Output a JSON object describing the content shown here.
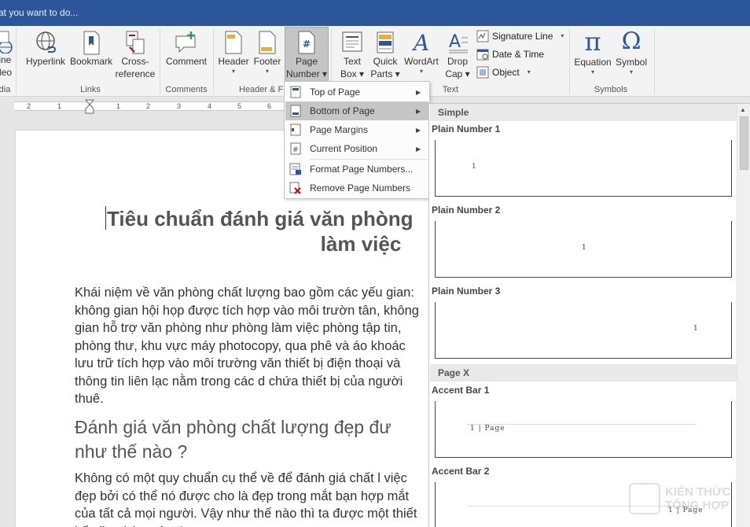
{
  "titlebar": {
    "tell_me": "at you want to do..."
  },
  "ribbon": {
    "left_cut": {
      "label1": "line",
      "label2": "deo",
      "group": "dia"
    },
    "hyperlink": "Hyperlink",
    "bookmark": "Bookmark",
    "cross_reference_1": "Cross-",
    "cross_reference_2": "reference",
    "links_group": "Links",
    "comment": "Comment",
    "comments_group": "Comments",
    "header": "Header",
    "footer": "Footer",
    "page_number_1": "Page",
    "page_number_2": "Number",
    "header_footer_group": "Header & F",
    "text_box_1": "Text",
    "text_box_2": "Box",
    "quick_parts_1": "Quick",
    "quick_parts_2": "Parts",
    "wordart": "WordArt",
    "drop_cap_1": "Drop",
    "drop_cap_2": "Cap",
    "signature_line": "Signature Line",
    "date_time": "Date & Time",
    "object": "Object",
    "text_group": "Text",
    "equation": "Equation",
    "symbol": "Symbol",
    "symbols_group": "Symbols"
  },
  "ruler": {
    "marks": [
      "2",
      "1",
      "1",
      "2",
      "3",
      "4",
      "5",
      "6"
    ]
  },
  "menu": {
    "items": [
      {
        "label": "Top of Page",
        "submenu": true
      },
      {
        "label": "Bottom of Page",
        "submenu": true
      },
      {
        "label": "Page Margins",
        "submenu": true
      },
      {
        "label": "Current Position",
        "submenu": true
      },
      {
        "label": "Format Page Numbers...",
        "submenu": false
      },
      {
        "label": "Remove Page Numbers",
        "submenu": false
      }
    ]
  },
  "gallery": {
    "section_simple": "Simple",
    "section_pagex": "Page X",
    "items": [
      {
        "title": "Plain Number 1",
        "sample": "1"
      },
      {
        "title": "Plain Number 2",
        "sample": "1"
      },
      {
        "title": "Plain Number 3",
        "sample": "1"
      },
      {
        "title": "Accent Bar 1",
        "sample": "1 | Page"
      },
      {
        "title": "Accent Bar 2",
        "sample": "1 | Page"
      }
    ]
  },
  "document": {
    "title_line1": "Tiêu chuẩn đánh giá văn phòng",
    "title_line2": "làm việc",
    "para1": "Khái niệm về văn phòng chất lượng bao gồm các yếu gian: không gian hội họp được tích hợp vào môi trườn tân, không gian hỗ trợ văn phòng như phòng làm việc phòng tập tin, phòng thư, khu vực máy photocopy, qua phê và áo khoác lưu trữ tích hợp vào môi trường văn thiết bị điện thoại và thông tin liên lạc nằm trong các d chứa thiết bị của người thuê.",
    "heading2": "Đánh giá văn phòng chất lượng đẹp đư như thế nào ?",
    "para2": "Không có một quy chuẩn cụ thể về  để đánh giá chất l việc đẹp bởi có thể nó được cho là đẹp trong mắt bạn hợp mắt của tất cả mọi người. Vậy như thế nào thì  ta được một thiết kế văn phòng đẹp?"
  },
  "watermark": {
    "line1": "KIẾN THỨC",
    "line2": "TỔNG HỢP"
  },
  "colors": {
    "titlebar": "#2b579a",
    "menu_highlight": "#c6c6c6",
    "accent_icon": "#2b579a"
  }
}
